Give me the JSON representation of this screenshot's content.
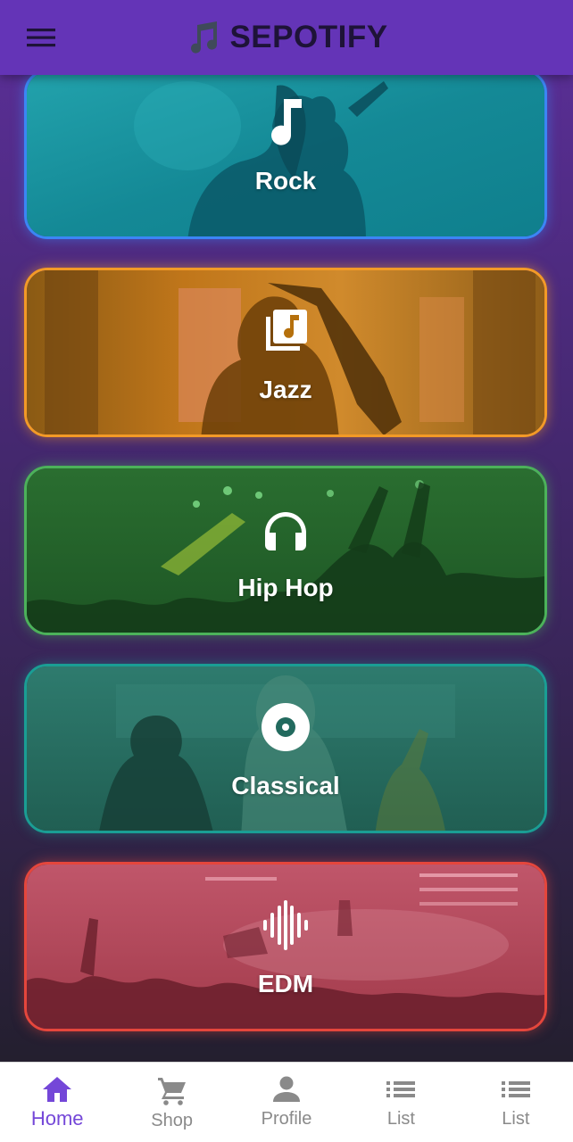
{
  "app": {
    "title": "SEPOTIFY",
    "brand_color": "#6434b7",
    "menu_icon": "hamburger-menu-icon",
    "logo_icon": "music-note-icon"
  },
  "genres": [
    {
      "label": "Rock",
      "icon": "music-note-icon",
      "border_color": "#3b86f5",
      "tint": "#118c9a"
    },
    {
      "label": "Jazz",
      "icon": "library-music-icon",
      "border_color": "#f39a26",
      "tint": "#b5700c"
    },
    {
      "label": "Hip Hop",
      "icon": "headphones-icon",
      "border_color": "#4cb25a",
      "tint": "#226b2c"
    },
    {
      "label": "Classical",
      "icon": "album-disc-icon",
      "border_color": "#1a9e94",
      "tint": "#226a5e"
    },
    {
      "label": "EDM",
      "icon": "graphic-eq-icon",
      "border_color": "#e5463c",
      "tint": "#b24052"
    }
  ],
  "bottom_nav": {
    "active_color": "#7447d8",
    "inactive_color": "#8a8a8a",
    "items": [
      {
        "label": "Home",
        "icon": "home-icon",
        "active": true
      },
      {
        "label": "Shop",
        "icon": "shopping-cart-icon",
        "active": false
      },
      {
        "label": "Profile",
        "icon": "person-icon",
        "active": false
      },
      {
        "label": "List",
        "icon": "list-icon",
        "active": false
      },
      {
        "label": "List",
        "icon": "list-icon",
        "active": false
      }
    ]
  }
}
